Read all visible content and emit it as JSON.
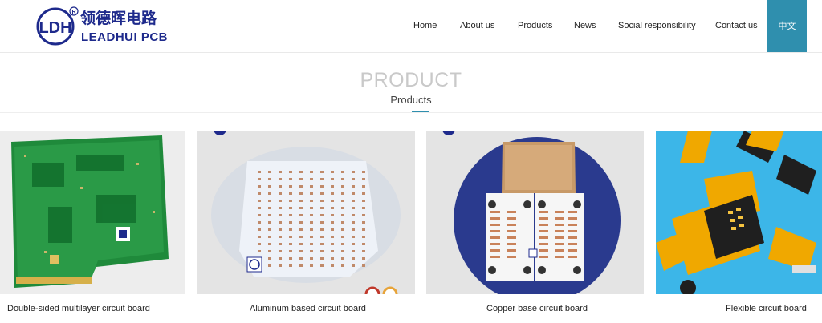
{
  "brand": {
    "name_cn": "领德晖电路",
    "name_en": "LEADHUI PCB",
    "mark": "LDH",
    "registered": "R"
  },
  "nav": {
    "items": [
      "Home",
      "About us",
      "Products",
      "News",
      "Social responsibility",
      "Contact us"
    ],
    "lang": "中文"
  },
  "section": {
    "title": "PRODUCT",
    "subtitle": "Products"
  },
  "products": [
    {
      "label": "Double-sided multilayer circuit board"
    },
    {
      "label": "Aluminum based circuit board"
    },
    {
      "label": "Copper base circuit board"
    },
    {
      "label": "Flexible circuit board"
    }
  ],
  "colors": {
    "brand_blue": "#1e2a8c",
    "accent": "#2f8fae",
    "pcb_green": "#1e8a3c",
    "flex_yellow": "#f0a800",
    "sky_blue": "#3cb6e8"
  }
}
